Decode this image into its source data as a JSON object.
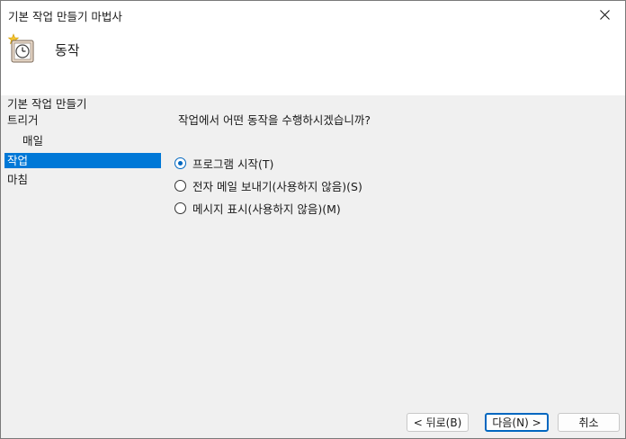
{
  "window": {
    "title": "기본 작업 만들기 마법사"
  },
  "header": {
    "title": "동작",
    "icon": "task-scheduler-clock-icon"
  },
  "sidebar": {
    "items": [
      {
        "label": "기본 작업 만들기",
        "selected": false
      },
      {
        "label": "트리거",
        "selected": false
      },
      {
        "label": "매일",
        "selected": false,
        "sub": true
      },
      {
        "label": "작업",
        "selected": true
      },
      {
        "label": "마침",
        "selected": false
      }
    ]
  },
  "main": {
    "question": "작업에서 어떤 동작을 수행하시겠습니까?",
    "options": [
      {
        "label": "프로그램 시작(T)",
        "checked": true
      },
      {
        "label": "전자 메일 보내기(사용하지 않음)(S)",
        "checked": false
      },
      {
        "label": "메시지 표시(사용하지 않음)(M)",
        "checked": false
      }
    ]
  },
  "buttons": {
    "back": "< 뒤로(B)",
    "next": "다음(N) >",
    "cancel": "취소"
  },
  "colors": {
    "accent": "#0078d7",
    "radio_accent": "#0067c0",
    "header_bg": "#ffffff",
    "body_bg": "#f0f0f0"
  }
}
